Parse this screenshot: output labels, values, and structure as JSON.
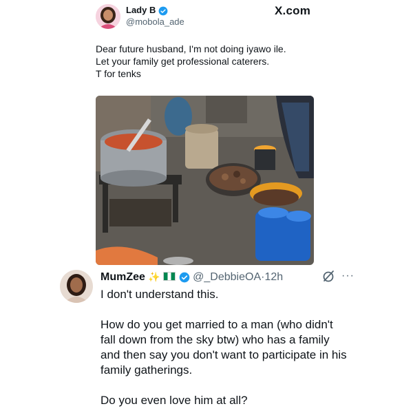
{
  "brand": {
    "label": "X.com"
  },
  "top_tweet": {
    "author_name": "Lady B",
    "author_handle": "@mobola_ade",
    "lines": [
      "Dear future husband, I'm not doing iyawo ile.",
      "Let your family get professional caterers.",
      "T for tenks"
    ],
    "photo_icon": "cooking-photo"
  },
  "reply": {
    "author_name": "MumZee",
    "author_handle": "@_DebbieOA",
    "separator": "·",
    "time": "12h",
    "paragraphs": [
      "I don't understand this.",
      "How do you get married to a man (who didn't fall down from the sky btw) who has a family and then say you don't want to participate in his family gatherings.",
      "Do you even love him at all?"
    ]
  },
  "colors": {
    "verified_blue": "#1d9bf0",
    "text": "#0f1419",
    "muted": "#536471"
  }
}
